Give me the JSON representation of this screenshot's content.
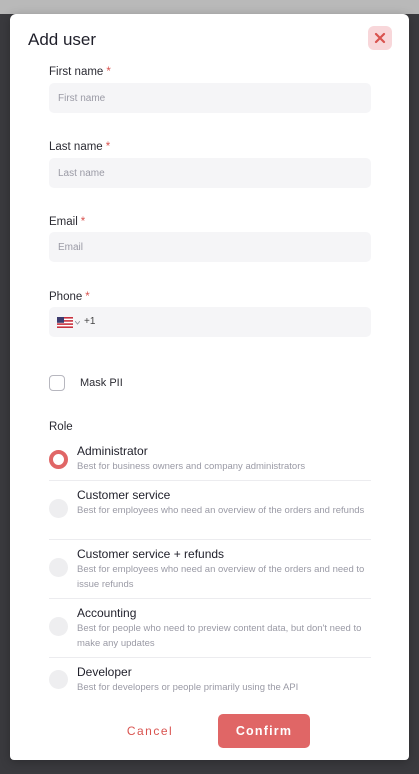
{
  "modal": {
    "title": "Add user"
  },
  "colors": {
    "accent": "#e06666",
    "required": "#d9534f",
    "input_bg": "#f5f5f7"
  },
  "icons": {
    "close": "close-icon",
    "flag": "us-flag-icon"
  },
  "form": {
    "first_name": {
      "label": "First name",
      "required_mark": "*",
      "placeholder": "First name",
      "value": ""
    },
    "last_name": {
      "label": "Last name",
      "required_mark": "*",
      "placeholder": "Last name",
      "value": ""
    },
    "email": {
      "label": "Email",
      "required_mark": "*",
      "placeholder": "Email",
      "value": ""
    },
    "phone": {
      "label": "Phone",
      "required_mark": "*",
      "dial_code": "+1",
      "country": "US"
    },
    "mask_pii": {
      "label": "Mask PII",
      "checked": false
    }
  },
  "role": {
    "label": "Role",
    "selected": "Administrator",
    "options": [
      {
        "title": "Administrator",
        "description": "Best for business owners and company administrators"
      },
      {
        "title": "Customer service",
        "description": "Best for employees who need an overview of the orders and refunds"
      },
      {
        "title": "Customer service + refunds",
        "description": "Best for employees who need an overview of the orders and need to issue refunds"
      },
      {
        "title": "Accounting",
        "description": "Best for people who need to preview content data, but don't need to make any updates"
      },
      {
        "title": "Developer",
        "description": "Best for developers or people primarily using the API"
      }
    ]
  },
  "actions": {
    "cancel": "Cancel",
    "confirm": "Confirm"
  }
}
